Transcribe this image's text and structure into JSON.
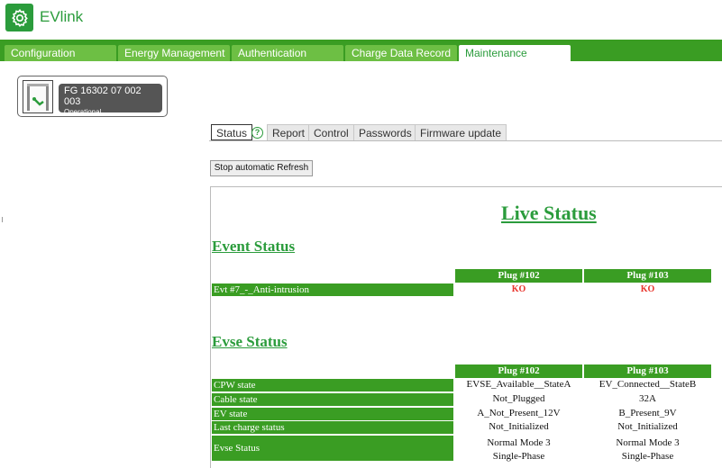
{
  "app": {
    "title": "EVlink",
    "logo_icon": "gear-icon",
    "accent": "#2b9c3c"
  },
  "nav": {
    "tabs": [
      {
        "label": "Configuration",
        "active": false
      },
      {
        "label": "Energy Management",
        "active": false
      },
      {
        "label": "Authentication",
        "active": false
      },
      {
        "label": "Charge Data Record",
        "active": false
      },
      {
        "label": "Maintenance",
        "active": true
      }
    ]
  },
  "device": {
    "id": "FG 16302 07 002 003",
    "state": "Operational",
    "icon": "charging-station-icon"
  },
  "subtabs": {
    "items": [
      {
        "label": "Status",
        "active": true
      },
      {
        "label": "Report",
        "active": false
      },
      {
        "label": "Control",
        "active": false
      },
      {
        "label": "Passwords",
        "active": false
      },
      {
        "label": "Firmware update",
        "active": false
      }
    ],
    "help_icon": "?"
  },
  "toolbar": {
    "refresh_button": "Stop automatic Refresh"
  },
  "live_status": {
    "title": "Live Status",
    "event_section": {
      "title": "Event Status",
      "headers": [
        "Plug #102",
        "Plug #103"
      ],
      "rows": [
        {
          "label": "Evt #7_-_Anti-intrusion",
          "values": [
            "KO",
            "KO"
          ]
        }
      ]
    },
    "evse_section": {
      "title": "Evse Status",
      "headers": [
        "Plug #102",
        "Plug #103"
      ],
      "rows": [
        {
          "label": "CPW state",
          "values": [
            "EVSE_Available__StateA",
            "EV_Connected__StateB"
          ]
        },
        {
          "label": "Cable state",
          "values": [
            "Not_Plugged",
            "32A"
          ]
        },
        {
          "label": "EV state",
          "values": [
            "A_Not_Present_12V",
            "B_Present_9V"
          ]
        },
        {
          "label": "Last charge status",
          "values": [
            "Not_Initialized",
            "Not_Initialized"
          ]
        },
        {
          "label": "Evse Status",
          "values": [
            "Normal Mode 3",
            "Normal Mode 3"
          ],
          "values_line2": [
            "Single-Phase",
            "Single-Phase"
          ]
        }
      ]
    }
  }
}
